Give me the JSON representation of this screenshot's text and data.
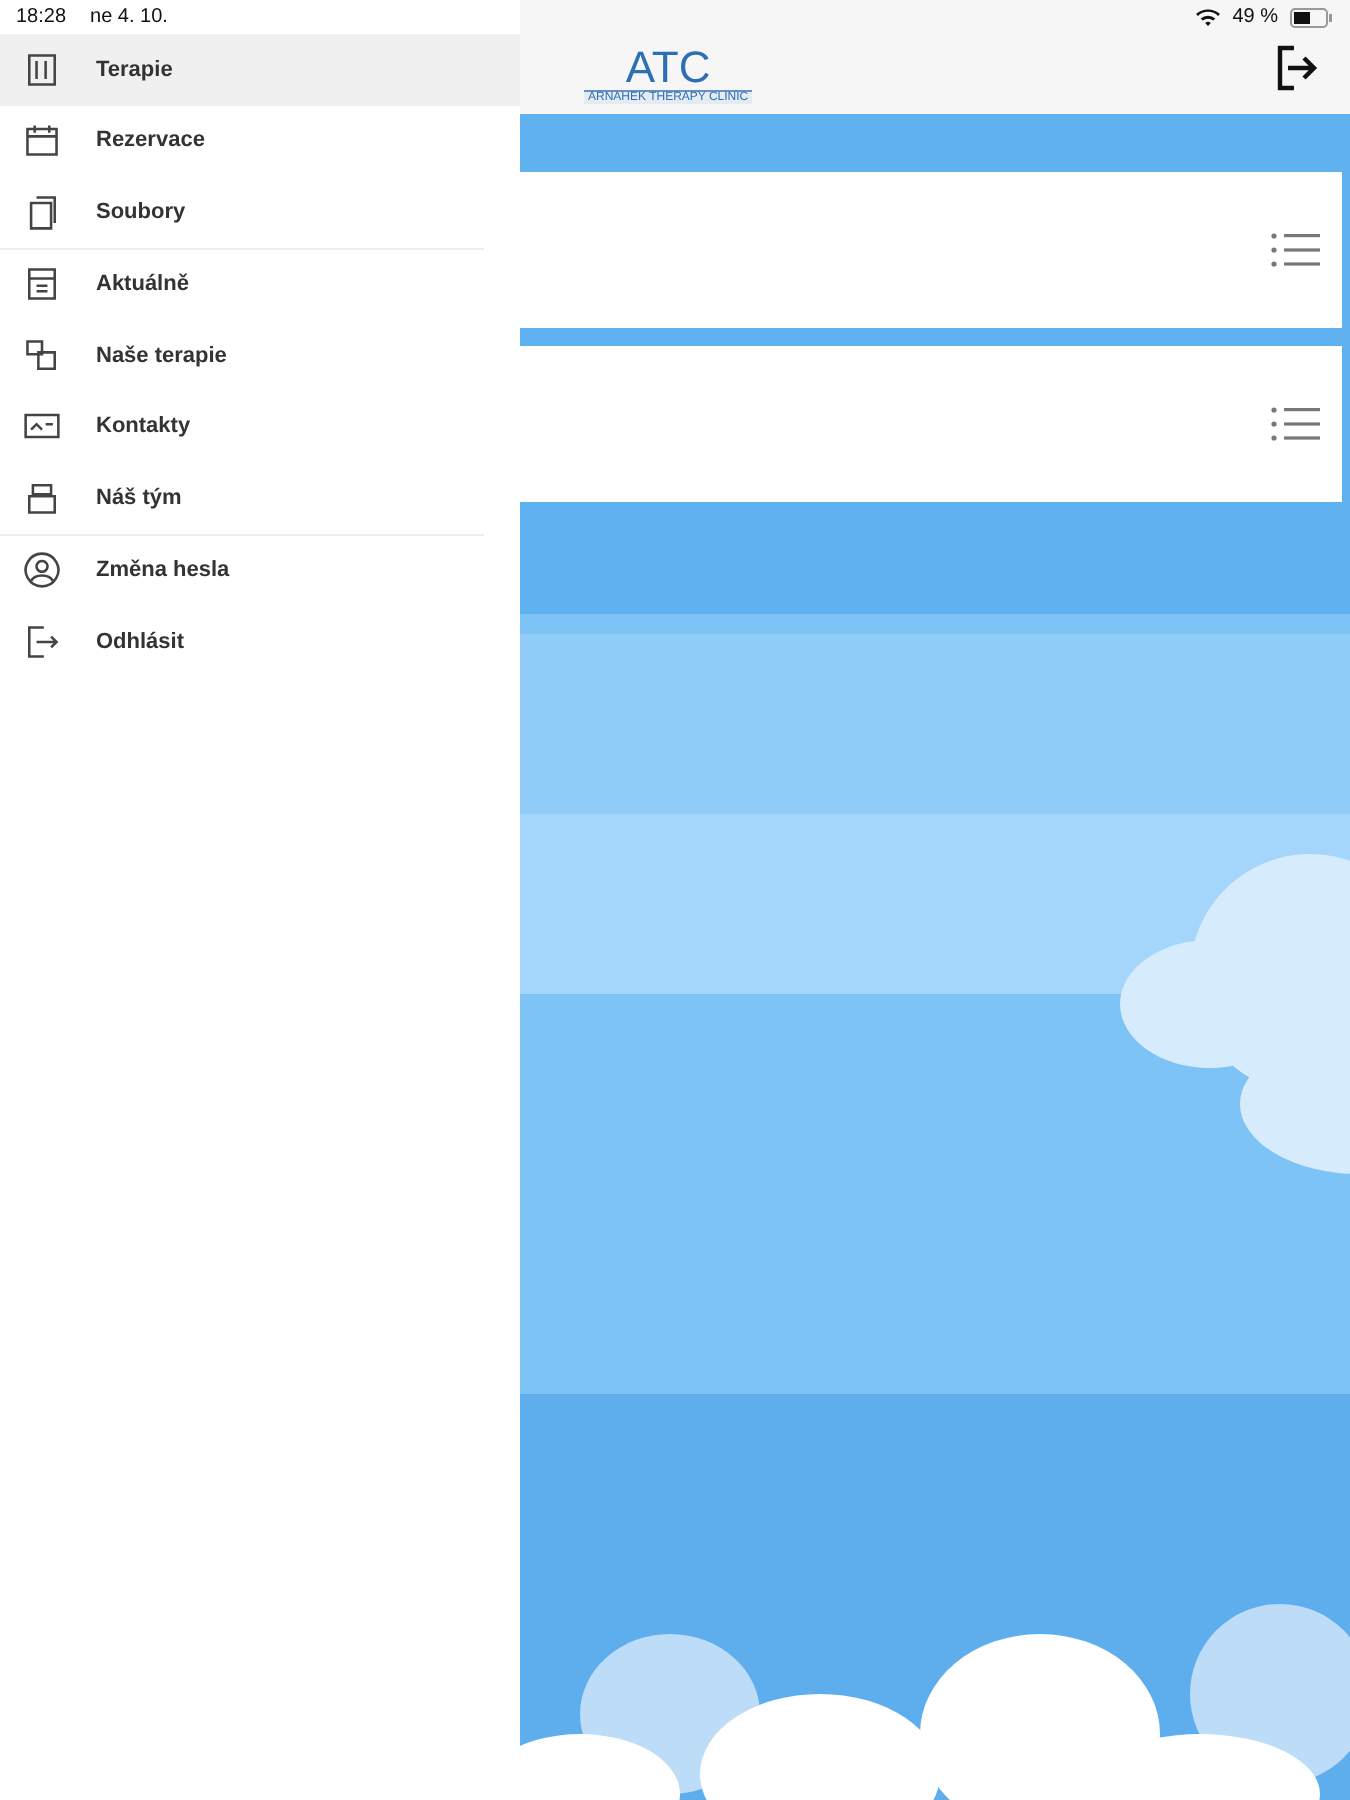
{
  "status_bar": {
    "time": "18:28",
    "date": "ne 4. 10.",
    "battery": "49 %"
  },
  "sidebar": {
    "sections": [
      {
        "items": [
          {
            "label": "Terapie",
            "selected": true
          },
          {
            "label": "Rezervace",
            "selected": false
          },
          {
            "label": "Soubory",
            "selected": false
          }
        ]
      },
      {
        "items": [
          {
            "label": "Aktuálně",
            "selected": false
          },
          {
            "label": "Naše terapie",
            "selected": false
          },
          {
            "label": "Kontakty",
            "selected": false
          },
          {
            "label": "Náš tým",
            "selected": false
          }
        ]
      },
      {
        "items": [
          {
            "label": "Změna hesla",
            "selected": false
          },
          {
            "label": "Odhlásit",
            "selected": false
          }
        ]
      }
    ]
  },
  "header": {
    "logo": "ATC",
    "logo_subtitle": "ARNAHEK THERAPY CLINIC"
  },
  "cards": [
    {
      "kind": "list"
    },
    {
      "kind": "list"
    }
  ]
}
